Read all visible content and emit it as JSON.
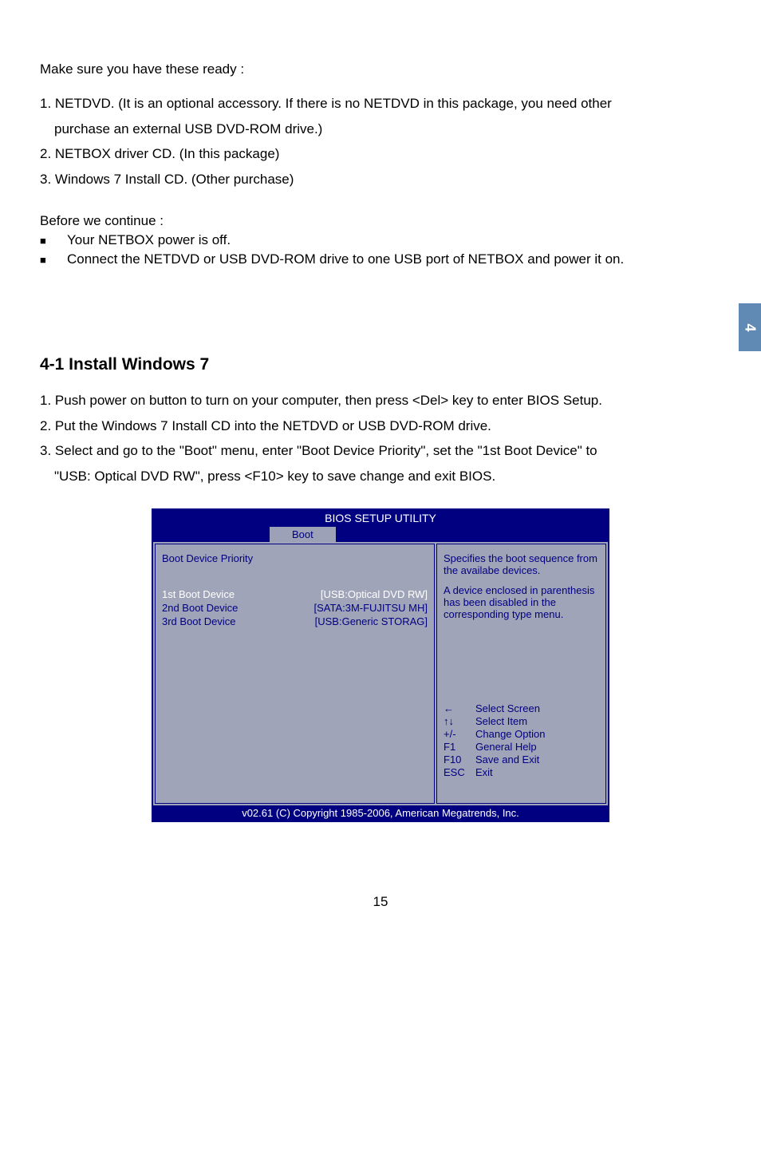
{
  "intro": "Make sure you have these ready :",
  "prep": {
    "item1a": "1. NETDVD. (It is an optional accessory. If there is no NETDVD in this package, you need other",
    "item1b": "purchase an external USB DVD-ROM drive.)",
    "item2": "2. NETBOX driver CD. (In this package)",
    "item3": "3. Windows 7 Install CD. (Other purchase)"
  },
  "before_head": "Before we continue :",
  "before": {
    "b1": "Your NETBOX power is off.",
    "b2": "Connect the NETDVD or USB DVD-ROM drive to one USB port of NETBOX and power it on."
  },
  "side_tab": "4",
  "section_title": "4-1 Install Windows 7",
  "steps": {
    "s1": "1. Push power on button to turn on your computer, then press <Del> key to enter BIOS Setup.",
    "s2": "2. Put the Windows 7 Install CD into the NETDVD or USB DVD-ROM drive.",
    "s3a": "3.  Select and go to the \"Boot\" menu, enter \"Boot Device Priority\", set the \"1st Boot Device\" to",
    "s3b": "\"USB: Optical DVD RW\", press <F10> key to save change and exit BIOS."
  },
  "bios": {
    "title": "BIOS SETUP UTILITY",
    "tab": "Boot",
    "priority_label": "Boot Device Priority",
    "rows": [
      {
        "label": "1st Boot Device",
        "value": "[USB:Optical DVD RW]"
      },
      {
        "label": "2nd Boot Device",
        "value": "[SATA:3M-FUJITSU MH]"
      },
      {
        "label": "3rd Boot Device",
        "value": "[USB:Generic STORAG]"
      }
    ],
    "desc1": "Specifies the boot sequence from the availabe devices.",
    "desc2": "A device enclosed in parenthesis has been disabled in the corresponding type menu.",
    "keys": [
      {
        "k": "←",
        "v": "Select Screen"
      },
      {
        "k": "↑↓",
        "v": "Select Item"
      },
      {
        "k": "+/-",
        "v": "Change Option"
      },
      {
        "k": "F1",
        "v": "General Help"
      },
      {
        "k": "F10",
        "v": "Save and Exit"
      },
      {
        "k": "ESC",
        "v": "Exit"
      }
    ],
    "footer": "v02.61 (C) Copyright 1985-2006, American Megatrends, Inc."
  },
  "page_number": "15"
}
